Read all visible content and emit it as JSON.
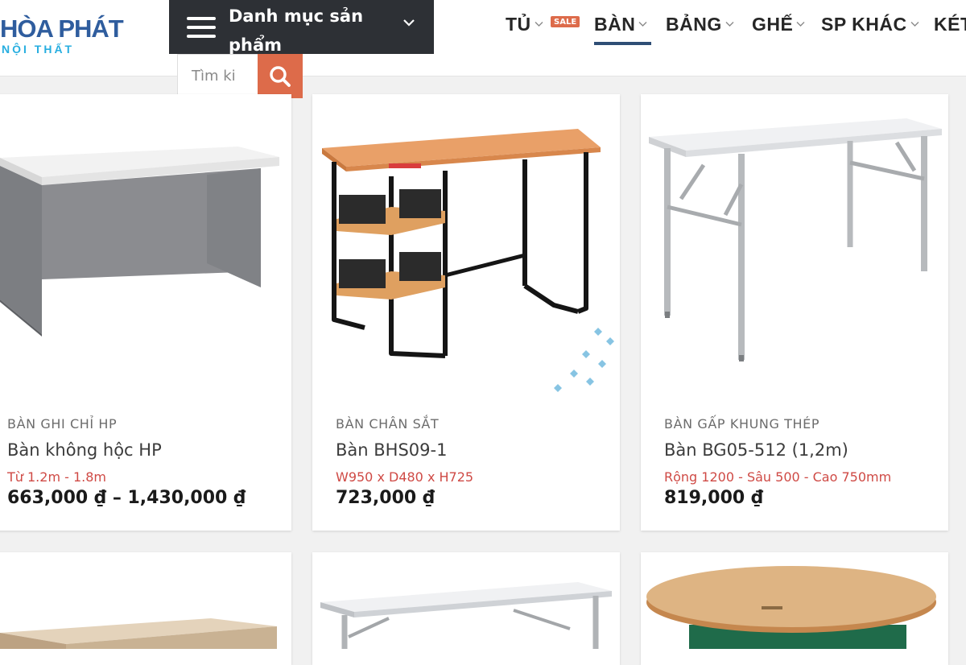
{
  "header": {
    "logo": {
      "main": "HÒA PHÁT",
      "sub": "NỘI THẤT"
    },
    "category_menu": {
      "label": "Danh mục sản phẩm",
      "icon": "hamburger-icon"
    },
    "search": {
      "placeholder": "Tìm ki",
      "icon": "search-icon"
    },
    "nav": [
      {
        "label": "TỦ",
        "badge": "SALE"
      },
      {
        "label": "BÀN",
        "active": true
      },
      {
        "label": "BẢNG"
      },
      {
        "label": "GHẾ"
      },
      {
        "label": "SP KHÁC"
      },
      {
        "label": "KÉT"
      }
    ]
  },
  "products": [
    {
      "category": "BÀN GHI CHỈ HP",
      "name": "Bàn không hộc HP",
      "spec": "Từ 1.2m - 1.8m",
      "price": "663,000 ₫ – 1,430,000 ₫"
    },
    {
      "category": "BÀN CHÂN SẮT",
      "name": "Bàn BHS09-1",
      "spec": "W950 x D480 x H725",
      "price": "723,000 ₫"
    },
    {
      "category": "BÀN GẤP KHUNG THÉP",
      "name": "Bàn BG05-512 (1,2m)",
      "spec": "Rộng 1200 - Sâu 500 - Cao 750mm",
      "price": "819,000 ₫"
    }
  ],
  "colors": {
    "brand_blue": "#2f5d9e",
    "accent_orange": "#dd6b4a",
    "dark_menu": "#2d3035",
    "spec_red": "#cf4a45"
  }
}
